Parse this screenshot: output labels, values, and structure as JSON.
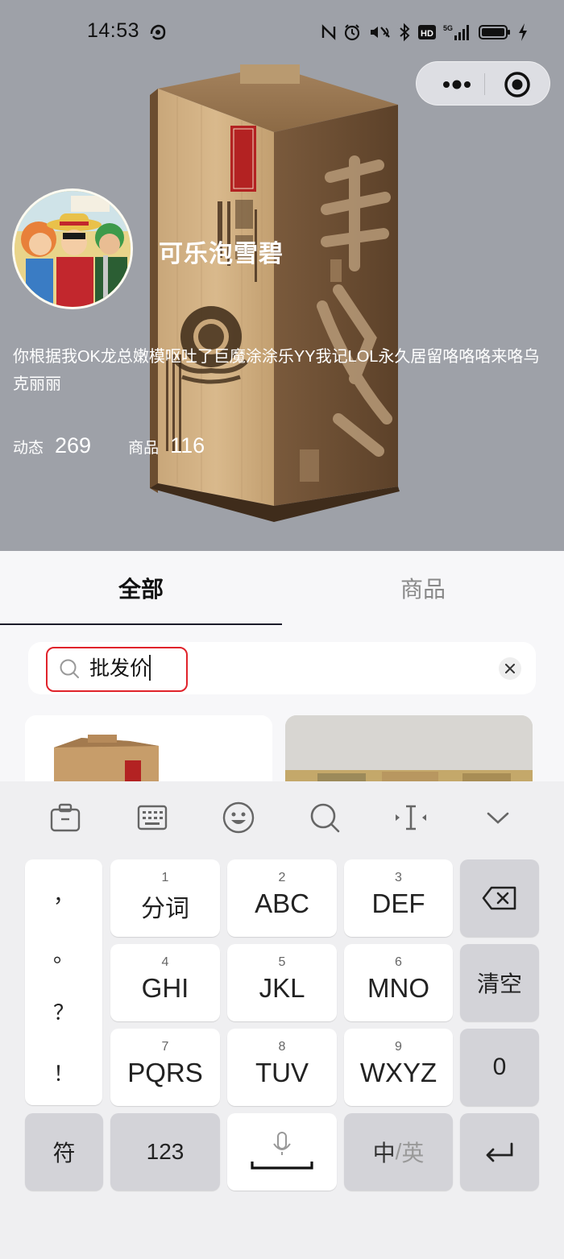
{
  "status_bar": {
    "time": "14:53",
    "icons": [
      "nfc-icon",
      "alarm-icon",
      "mute-icon",
      "bluetooth-icon",
      "hd-icon",
      "5g-signal-icon",
      "battery-icon",
      "charging-icon"
    ]
  },
  "capsule": {
    "more_icon": "more-dots-icon",
    "close_icon": "target-circle-icon"
  },
  "shop": {
    "name": "可乐泡雪碧",
    "description": "你根据我OK龙总嫩模呕吐了巨魔涂涂乐YY我记LOL永久居留咯咯咯来咯乌克丽丽",
    "stats": [
      {
        "label": "动态",
        "value": "269"
      },
      {
        "label": "商品",
        "value": "116"
      }
    ]
  },
  "tabs": [
    {
      "label": "全部",
      "active": true
    },
    {
      "label": "商品",
      "active": false
    }
  ],
  "search": {
    "value": "批发价",
    "placeholder": ""
  },
  "keyboard": {
    "toolbar": [
      "clipboard-icon",
      "keyboard-icon",
      "emoji-icon",
      "search-icon",
      "cursor-move-icon",
      "collapse-icon"
    ],
    "punctuation": [
      "，",
      "。",
      "？",
      "！"
    ],
    "keys": [
      {
        "num": "1",
        "label": "分词"
      },
      {
        "num": "2",
        "label": "ABC"
      },
      {
        "num": "3",
        "label": "DEF"
      },
      {
        "num": "4",
        "label": "GHI"
      },
      {
        "num": "5",
        "label": "JKL"
      },
      {
        "num": "6",
        "label": "MNO"
      },
      {
        "num": "7",
        "label": "PQRS"
      },
      {
        "num": "8",
        "label": "TUV"
      },
      {
        "num": "9",
        "label": "WXYZ"
      }
    ],
    "clear": "清空",
    "zero": "0",
    "symbols": "符",
    "numbers": "123",
    "lang_zh": "中",
    "lang_sep": "/",
    "lang_en": "英"
  },
  "colors": {
    "hero_bg": "#9ea1a8",
    "highlight": "#e0232b",
    "tab_indicator": "#1b1b2a"
  }
}
